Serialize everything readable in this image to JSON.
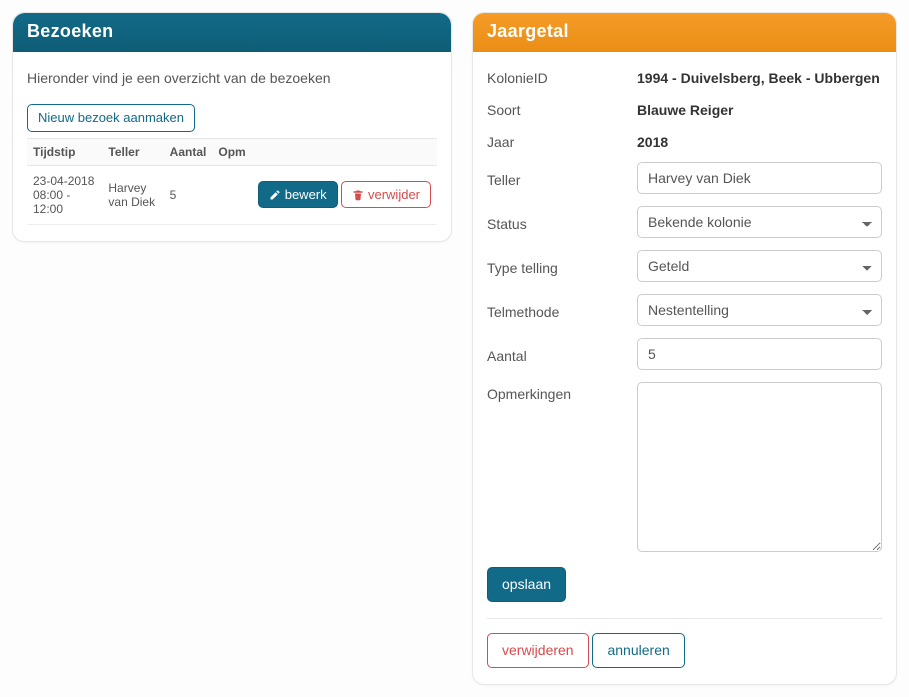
{
  "left": {
    "title": "Bezoeken",
    "intro": "Hieronder vind je een overzicht van de bezoeken",
    "new_visit_label": "Nieuw bezoek aanmaken",
    "columns": {
      "tijdstip": "Tijdstip",
      "teller": "Teller",
      "aantal": "Aantal",
      "opm": "Opm"
    },
    "row": {
      "tijdstip": "23-04-2018 08:00 - 12:00",
      "teller": "Harvey van Diek",
      "aantal": "5",
      "opm": ""
    },
    "edit_label": "bewerk",
    "delete_label": "verwijder"
  },
  "right": {
    "title": "Jaargetal",
    "labels": {
      "kolonieid": "KolonieID",
      "soort": "Soort",
      "jaar": "Jaar",
      "teller": "Teller",
      "status": "Status",
      "type_telling": "Type telling",
      "telmethode": "Telmethode",
      "aantal": "Aantal",
      "opmerkingen": "Opmerkingen"
    },
    "values": {
      "kolonieid": "1994 - Duivelsberg, Beek - Ubbergen",
      "soort": "Blauwe Reiger",
      "jaar": "2018",
      "teller": "Harvey van Diek",
      "status": "Bekende kolonie",
      "type_telling": "Geteld",
      "telmethode": "Nestentelling",
      "aantal": "5",
      "opmerkingen": ""
    },
    "buttons": {
      "save": "opslaan",
      "delete": "verwijderen",
      "cancel": "annuleren"
    }
  }
}
